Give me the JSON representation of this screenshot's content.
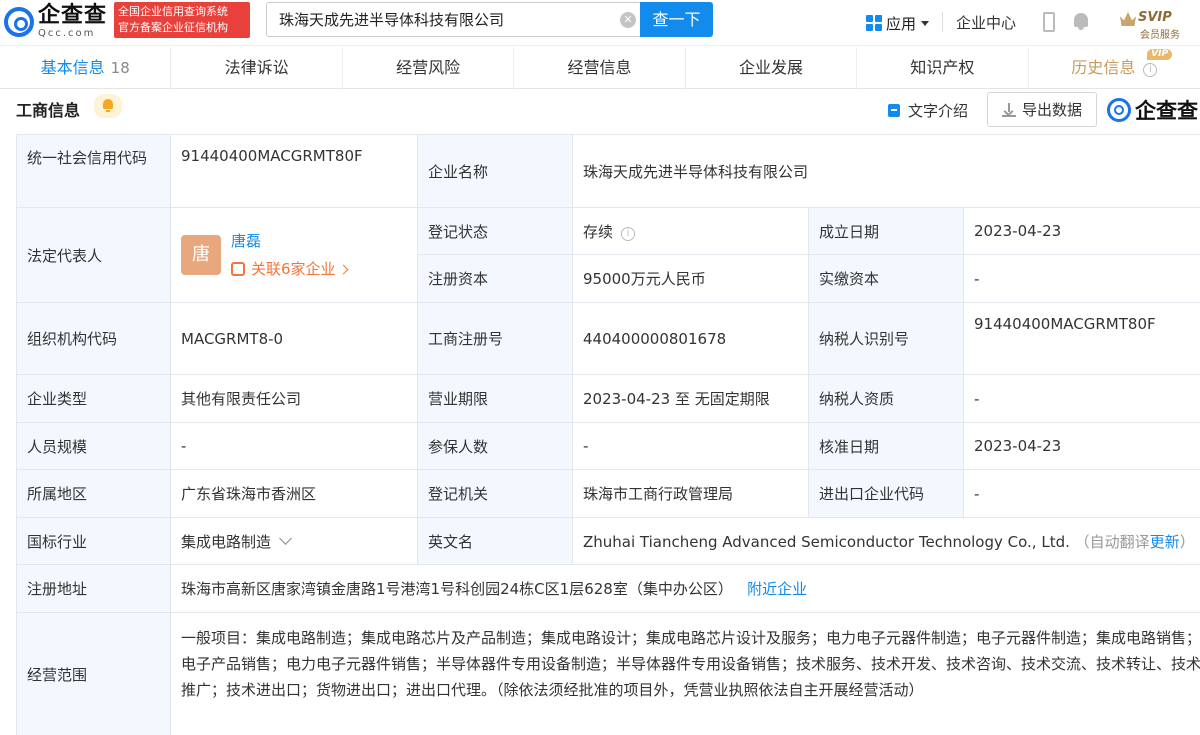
{
  "header": {
    "logo_cn": "企查查",
    "logo_en": "Qcc.com",
    "badge_line1": "全国企业信用查询系统",
    "badge_line2": "官方备案企业征信机构",
    "search_value": "珠海天成先进半导体科技有限公司",
    "search_button": "查一下",
    "apps_label": "应用",
    "company_center": "企业中心",
    "svip_label": "SVIP",
    "svip_sub": "会员服务"
  },
  "tabs": [
    {
      "label": "基本信息",
      "count": "18"
    },
    {
      "label": "法律诉讼"
    },
    {
      "label": "经营风险"
    },
    {
      "label": "经营信息"
    },
    {
      "label": "企业发展"
    },
    {
      "label": "知识产权"
    },
    {
      "label": "历史信息",
      "badge": "VIP"
    }
  ],
  "section": {
    "title": "工商信息",
    "text_intro": "文字介绍",
    "export": "导出数据",
    "watermark": "企查查"
  },
  "table": {
    "credit_code_label": "统一社会信用代码",
    "credit_code": "91440400MACGRMT80F",
    "company_name_label": "企业名称",
    "company_name": "珠海天成先进半导体科技有限公司",
    "legal_rep_label": "法定代表人",
    "legal_rep_avatar": "唐",
    "legal_rep_name": "唐磊",
    "legal_rep_related": "关联6家企业",
    "reg_status_label": "登记状态",
    "reg_status": "存续",
    "est_date_label": "成立日期",
    "est_date": "2023-04-23",
    "reg_capital_label": "注册资本",
    "reg_capital": "95000万元人民币",
    "paid_capital_label": "实缴资本",
    "paid_capital": "-",
    "org_code_label": "组织机构代码",
    "org_code": "MACGRMT8-0",
    "biz_reg_no_label": "工商注册号",
    "biz_reg_no": "440400000801678",
    "tax_id_label": "纳税人识别号",
    "tax_id": "91440400MACGRMT80F",
    "company_type_label": "企业类型",
    "company_type": "其他有限责任公司",
    "biz_term_label": "营业期限",
    "biz_term": "2023-04-23 至 无固定期限",
    "tax_qual_label": "纳税人资质",
    "tax_qual": "-",
    "staff_size_label": "人员规模",
    "staff_size": "-",
    "insured_label": "参保人数",
    "insured": "-",
    "approval_date_label": "核准日期",
    "approval_date": "2023-04-23",
    "region_label": "所属地区",
    "region": "广东省珠海市香洲区",
    "reg_authority_label": "登记机关",
    "reg_authority": "珠海市工商行政管理局",
    "import_export_label": "进出口企业代码",
    "import_export": "-",
    "industry_label": "国标行业",
    "industry": "集成电路制造",
    "english_name_label": "英文名",
    "english_name": "Zhuhai Tiancheng Advanced Semiconductor Technology Co., Ltd.",
    "auto_translate": "（自动翻译",
    "update": "更新",
    "close_paren": "）",
    "address_label": "注册地址",
    "address": "珠海市高新区唐家湾镇金唐路1号港湾1号科创园24栋C区1层628室（集中办公区）",
    "nearby": "附近企业",
    "scope_label": "经营范围",
    "scope": "一般项目：集成电路制造；集成电路芯片及产品制造；集成电路设计；集成电路芯片设计及服务；电力电子元器件制造；电子元器件制造；集成电路销售；电子产品销售；电力电子元器件销售；半导体器件专用设备制造；半导体器件专用设备销售；技术服务、技术开发、技术咨询、技术交流、技术转让、技术推广；技术进出口；货物进出口；进出口代理。（除依法须经批准的项目外，凭营业执照依法自主开展经营活动）"
  }
}
